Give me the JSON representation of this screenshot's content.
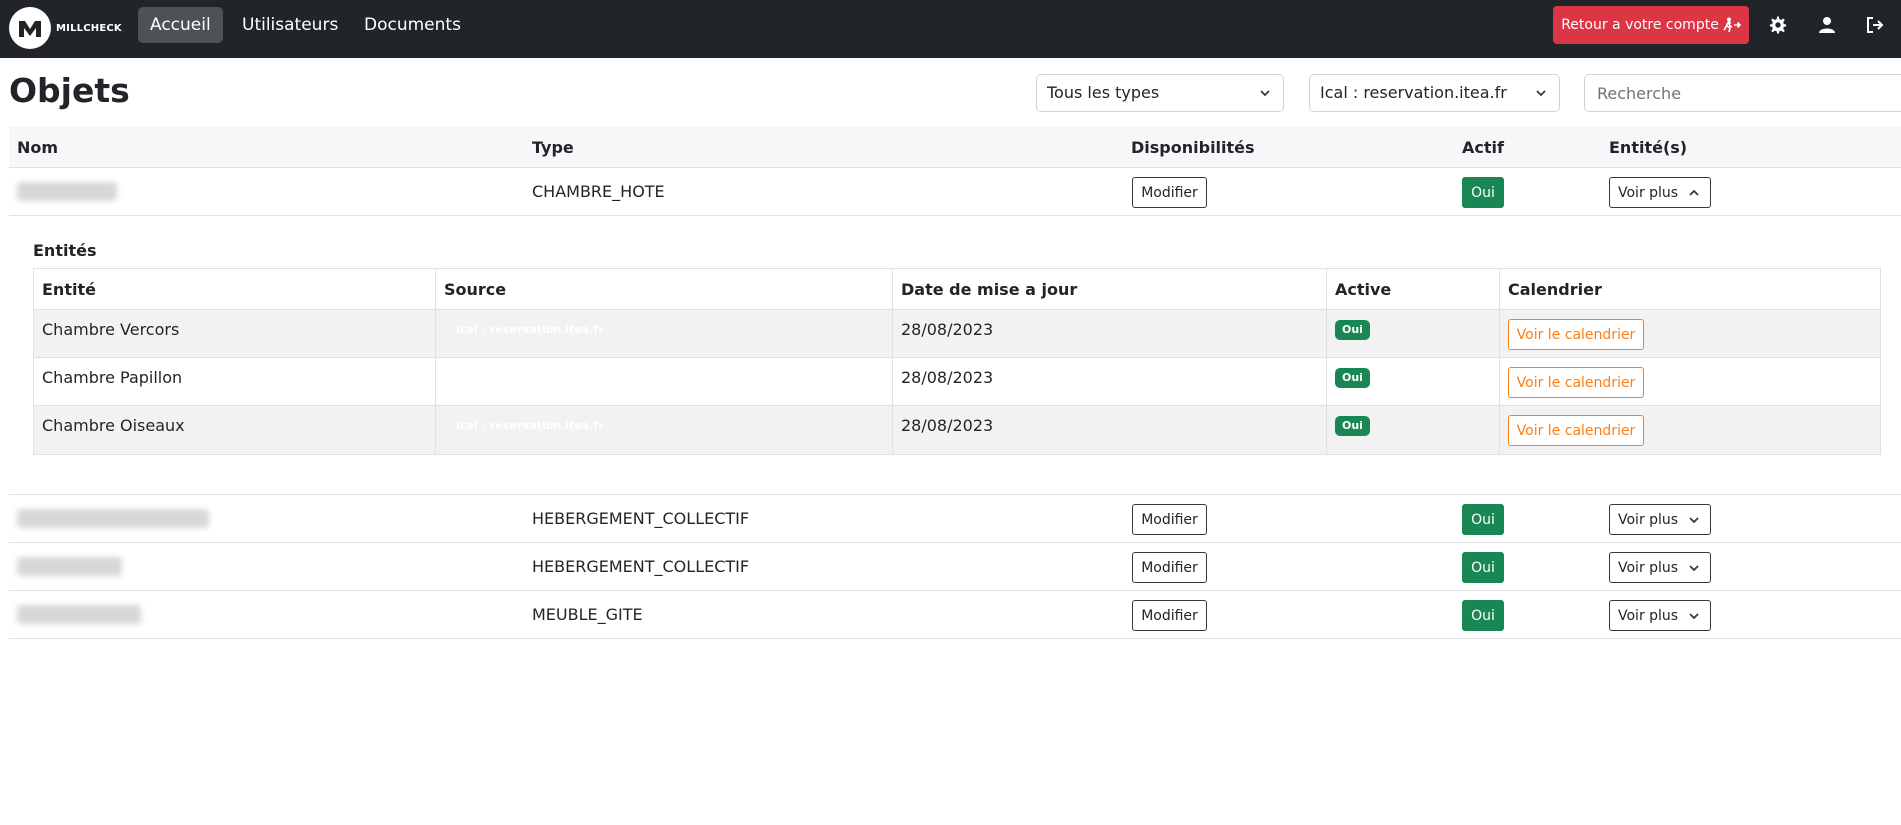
{
  "brand": {
    "name": "MILLCHECK"
  },
  "nav": {
    "links": [
      "Accueil",
      "Utilisateurs",
      "Documents"
    ],
    "retour_label": "Retour a votre compte"
  },
  "page": {
    "title": "Objets",
    "type_filter": "Tous les types",
    "source_filter": "Ical : reservation.itea.fr",
    "search_placeholder": "Recherche"
  },
  "table": {
    "headers": [
      "Nom",
      "Type",
      "Disponibilités",
      "Actif",
      "Entité(s)"
    ],
    "rows": [
      {
        "type": "CHAMBRE_HOTE",
        "modify_label": "Modifier",
        "actif": "Oui",
        "voir_label": "Voir plus",
        "expanded": true
      },
      {
        "type": "HEBERGEMENT_COLLECTIF",
        "modify_label": "Modifier",
        "actif": "Oui",
        "voir_label": "Voir plus",
        "expanded": false
      },
      {
        "type": "HEBERGEMENT_COLLECTIF",
        "modify_label": "Modifier",
        "actif": "Oui",
        "voir_label": "Voir plus",
        "expanded": false
      },
      {
        "type": "MEUBLE_GITE",
        "modify_label": "Modifier",
        "actif": "Oui",
        "voir_label": "Voir plus",
        "expanded": false
      }
    ]
  },
  "entities": {
    "title": "Entités",
    "headers": [
      "Entité",
      "Source",
      "Date de mise a jour",
      "Active",
      "Calendrier"
    ],
    "rows": [
      {
        "name": "Chambre Vercors",
        "source": "Ical : reservation.itea.fr",
        "date": "28/08/2023",
        "active": "Oui",
        "calendar_label": "Voir le calendrier"
      },
      {
        "name": "Chambre Papillon",
        "source": "",
        "date": "28/08/2023",
        "active": "Oui",
        "calendar_label": "Voir le calendrier"
      },
      {
        "name": "Chambre Oiseaux",
        "source": "Ical : reservation.itea.fr",
        "date": "28/08/2023",
        "active": "Oui",
        "calendar_label": "Voir le calendrier"
      }
    ]
  },
  "colors": {
    "navbar": "#212529",
    "danger": "#dc3545",
    "success": "#198754",
    "warning_outline": "#fd7e14"
  },
  "icons": [
    "millcheck-logo-icon",
    "running-exit-icon",
    "gear-icon",
    "user-icon",
    "logout-icon",
    "chevron-down-icon",
    "chevron-up-icon"
  ]
}
